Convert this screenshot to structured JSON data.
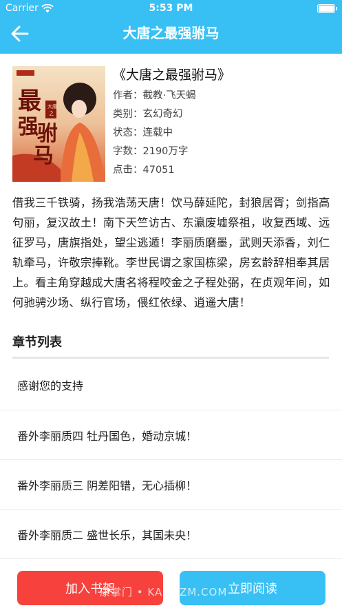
{
  "status_bar": {
    "carrier": "Carrier",
    "time": "5:53 PM"
  },
  "nav": {
    "title": "大唐之最强驸马"
  },
  "book": {
    "title": "《大唐之最强驸马》",
    "cover_text": "最强驸马",
    "cover_small": "大唐之",
    "info": [
      {
        "label": "作者：",
        "value": "截教·飞天蝎"
      },
      {
        "label": "类别：",
        "value": "玄幻奇幻"
      },
      {
        "label": "状态：",
        "value": "连载中"
      },
      {
        "label": "字数：",
        "value": "2190万字"
      },
      {
        "label": "点击：",
        "value": "47051"
      }
    ]
  },
  "description": "借我三千铁骑，扬我浩荡天唐！饮马薛延陀，封狼居胥；剑指高句丽，复汉故土！南下天竺访古、东瀛废墟祭祖，收复西域、远征罗马，唐旗指处，望尘逃遁！李丽质磨墨，武则天添香，刘仁轨牵马，许敬宗捧靴。李世民谓之家国栋梁，房玄龄辞相奉其居上。看主角穿越成大唐名将程咬金之子程处弼，在贞观年间，如何驰骋沙场、纵行官场，偎红依绿、逍遥大唐！",
  "chapters": {
    "section_title": "章节列表",
    "items": [
      "感谢您的支持",
      "番外李丽质四 牡丹国色，婚动京城！",
      "番外李丽质三 阴差阳错，无心插柳！",
      "番外李丽质二 盛世长乐，其国未央！"
    ]
  },
  "buttons": {
    "add_shelf": "加入书架",
    "read_now": "立即阅读"
  },
  "watermark": "康掌门 • KANGZM.COM",
  "colors": {
    "accent": "#38c0f4",
    "danger": "#f7413c"
  }
}
